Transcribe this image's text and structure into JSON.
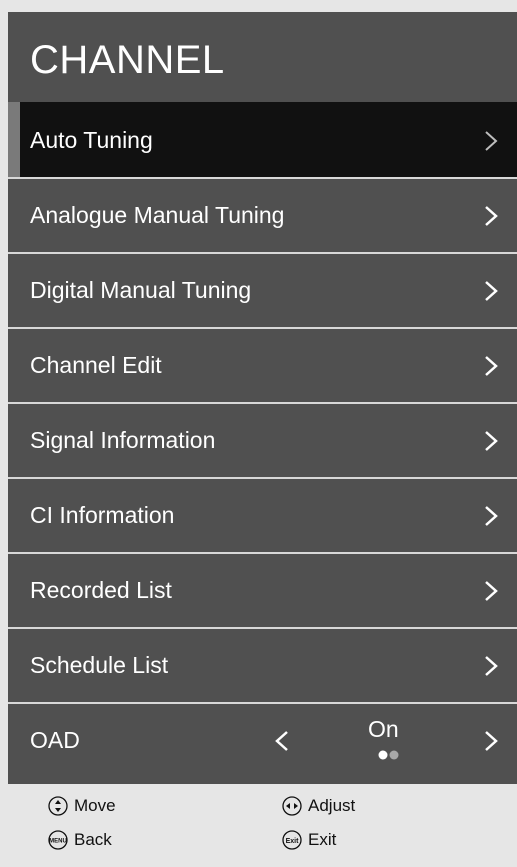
{
  "header": {
    "title": "CHANNEL"
  },
  "menu": {
    "items": [
      {
        "label": "Auto Tuning"
      },
      {
        "label": "Analogue Manual Tuning"
      },
      {
        "label": "Digital Manual Tuning"
      },
      {
        "label": "Channel Edit"
      },
      {
        "label": "Signal Information"
      },
      {
        "label": "CI Information"
      },
      {
        "label": "Recorded List"
      },
      {
        "label": "Schedule List"
      },
      {
        "label": "OAD",
        "value": "On"
      }
    ],
    "selected_index": 0
  },
  "footer": {
    "move": "Move",
    "adjust": "Adjust",
    "back": "Back",
    "exit": "Exit",
    "menu_key": "MENU",
    "exit_key": "Exit"
  },
  "colors": {
    "panel": "#505050",
    "selected": "#111111",
    "footer": "#e6e6e6",
    "text": "#ffffff"
  }
}
